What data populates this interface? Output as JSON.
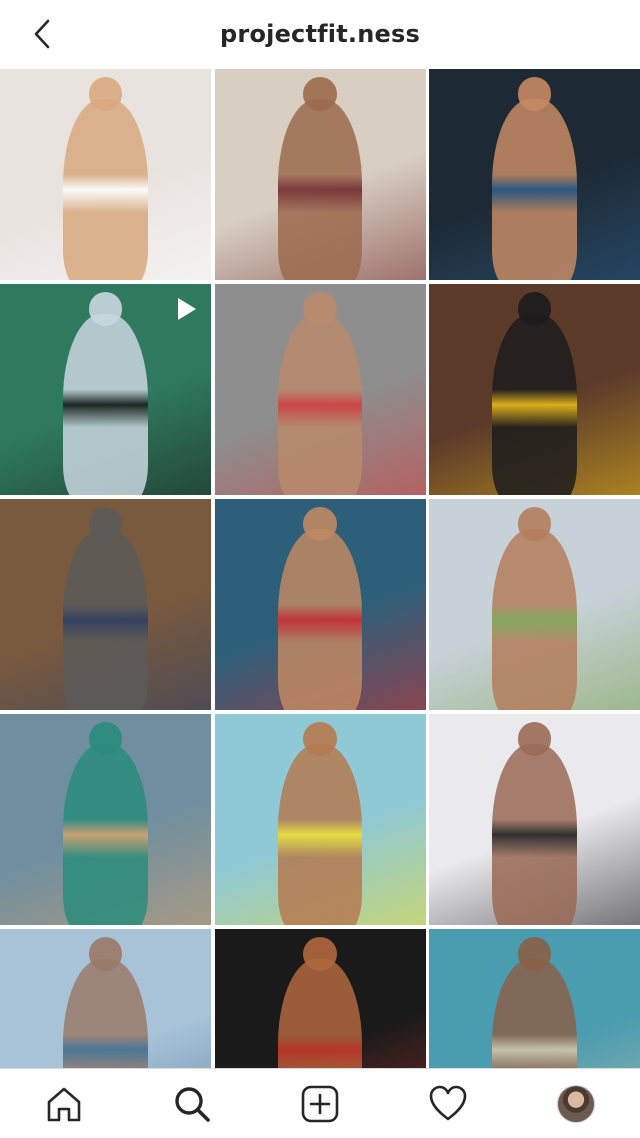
{
  "header": {
    "title": "projectfit.ness",
    "back_icon": "chevron-left-icon"
  },
  "grid": {
    "tiles": [
      {
        "name": "post-1",
        "is_video": false,
        "bg": "#e9e3df",
        "fg": "#d9a87f",
        "accent": "#ffffff"
      },
      {
        "name": "post-2",
        "is_video": false,
        "bg": "#d8cfc2",
        "fg": "#9c6a4e",
        "accent": "#6b1e24"
      },
      {
        "name": "post-3",
        "is_video": false,
        "bg": "#1d2a36",
        "fg": "#c58a63",
        "accent": "#2c5f8a"
      },
      {
        "name": "post-4",
        "is_video": true,
        "bg": "#2f7a5e",
        "fg": "#c9d6df",
        "accent": "#1a1a1a"
      },
      {
        "name": "post-5",
        "is_video": false,
        "bg": "#8e8e8e",
        "fg": "#b98a6c",
        "accent": "#d63a3a"
      },
      {
        "name": "post-6",
        "is_video": false,
        "bg": "#5b3a2a",
        "fg": "#1c1c1c",
        "accent": "#f2c21a"
      },
      {
        "name": "post-7",
        "is_video": false,
        "bg": "#7a5a3e",
        "fg": "#5c5a58",
        "accent": "#2a3f66"
      },
      {
        "name": "post-8",
        "is_video": false,
        "bg": "#2e5f7a",
        "fg": "#c08863",
        "accent": "#d82d2d"
      },
      {
        "name": "post-9",
        "is_video": false,
        "bg": "#c7d2d8",
        "fg": "#b47d5d",
        "accent": "#7aa04a"
      },
      {
        "name": "post-10",
        "is_video": false,
        "bg": "#6f8fa0",
        "fg": "#2a8c7c",
        "accent": "#d8a36a"
      },
      {
        "name": "post-11",
        "is_video": false,
        "bg": "#8fc9d6",
        "fg": "#b57a50",
        "accent": "#f2e02a"
      },
      {
        "name": "post-12",
        "is_video": false,
        "bg": "#e9e9ee",
        "fg": "#9a6a55",
        "accent": "#111111"
      },
      {
        "name": "post-13",
        "is_video": false,
        "bg": "#a8c3d8",
        "fg": "#9a7a68",
        "accent": "#3c6a8a"
      },
      {
        "name": "post-14",
        "is_video": false,
        "bg": "#1a1a1a",
        "fg": "#b0683e",
        "accent": "#d23a2a"
      },
      {
        "name": "post-15",
        "is_video": false,
        "bg": "#4a9cb0",
        "fg": "#8a6048",
        "accent": "#d9c8a8"
      }
    ]
  },
  "bottom_nav": {
    "items": [
      {
        "name": "home-icon"
      },
      {
        "name": "search-icon"
      },
      {
        "name": "add-post-icon"
      },
      {
        "name": "heart-icon"
      },
      {
        "name": "profile-avatar"
      }
    ]
  }
}
